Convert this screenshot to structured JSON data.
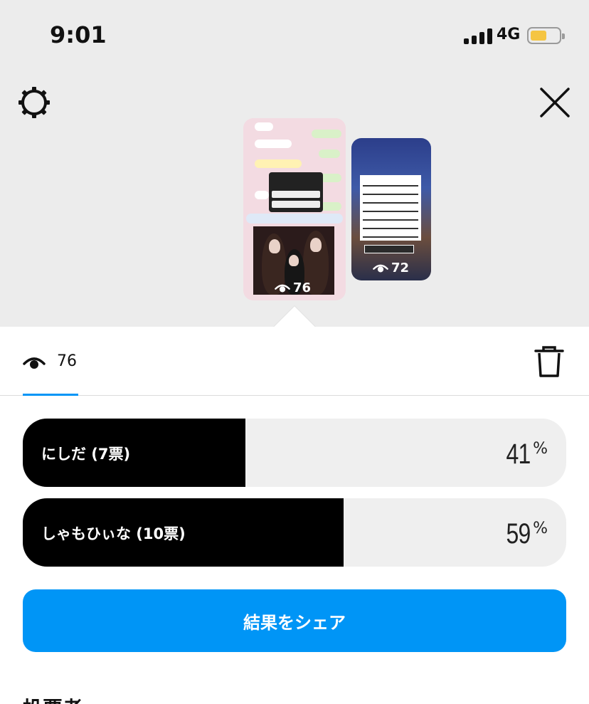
{
  "status_bar": {
    "time": "9:01",
    "network": "4G",
    "icons": [
      "signal-icon",
      "battery-icon"
    ],
    "battery_color": "#f5c542"
  },
  "header": {
    "left_icon": "settings-gear-icon",
    "right_icon": "close-icon"
  },
  "stories": [
    {
      "views": "76",
      "selected": true
    },
    {
      "views": "72",
      "selected": false
    }
  ],
  "viewers": {
    "icon": "eye-icon",
    "count": "76",
    "delete_icon": "trash-icon"
  },
  "poll": {
    "options": [
      {
        "label": "にしだ (7票)",
        "percent": "41",
        "percent_symbol": "%",
        "fill_fraction": 0.41
      },
      {
        "label": "しゃもひぃな (10票)",
        "percent": "59",
        "percent_symbol": "%",
        "fill_fraction": 0.59
      }
    ]
  },
  "share_button": {
    "label": "結果をシェア",
    "color": "#0095f6"
  },
  "section": {
    "heading": "投票者"
  },
  "colors": {
    "accent": "#0095f6",
    "background_top": "#ececec",
    "bar_track": "#efefef",
    "bar_fill": "#000000"
  }
}
